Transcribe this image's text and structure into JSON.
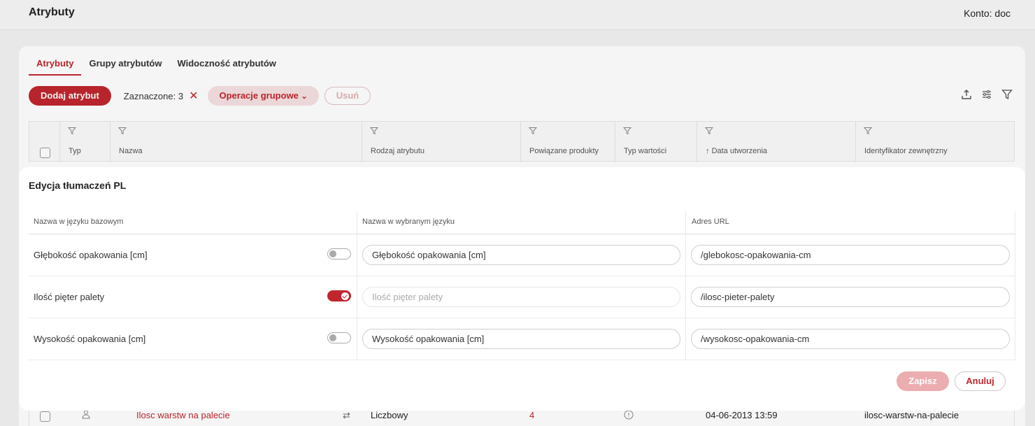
{
  "topbar": {
    "title": "Atrybuty",
    "account": "Konto: doc"
  },
  "tabs": [
    {
      "label": "Atrybuty",
      "active": true
    },
    {
      "label": "Grupy atrybutów",
      "active": false
    },
    {
      "label": "Widoczność atrybutów",
      "active": false
    }
  ],
  "toolbar": {
    "add_label": "Dodaj atrybut",
    "selected_label": "Zaznaczone: 3",
    "group_ops_label": "Operacje grupowe",
    "delete_label": "Usuń"
  },
  "table": {
    "columns": [
      "Typ",
      "Nazwa",
      "Rodzaj atrybutu",
      "Powiązane produkty",
      "Typ wartości",
      "Data utworzenia",
      "Identyfikator zewnętrzny"
    ],
    "visible_row": {
      "name": "Ilosc warstw na palecie",
      "kind": "Liczbowy",
      "products": "4",
      "created": "04-06-2013 13:59",
      "external_id": "ilosc-warstw-na-palecie"
    }
  },
  "modal": {
    "title": "Edycja tłumaczeń PL",
    "headers": {
      "base": "Nazwa w języku bazowym",
      "translated": "Nazwa w wybranym języku",
      "url": "Adres URL"
    },
    "rows": [
      {
        "base": "Głębokość opakowania [cm]",
        "toggle_on": false,
        "name_value": "Głębokość opakowania [cm]",
        "name_placeholder": "",
        "url": "/glebokosc-opakowania-cm"
      },
      {
        "base": "Ilość pięter palety",
        "toggle_on": true,
        "name_value": "",
        "name_placeholder": "Ilość pięter palety",
        "url": "/ilosc-pieter-palety"
      },
      {
        "base": "Wysokość opakowania [cm]",
        "toggle_on": false,
        "name_value": "Wysokość opakowania [cm]",
        "name_placeholder": "",
        "url": "/wysokosc-opakowania-cm"
      }
    ],
    "save_label": "Zapisz",
    "cancel_label": "Anuluj"
  },
  "colors": {
    "accent": "#c0262d",
    "accent_light": "#ecadb0"
  }
}
